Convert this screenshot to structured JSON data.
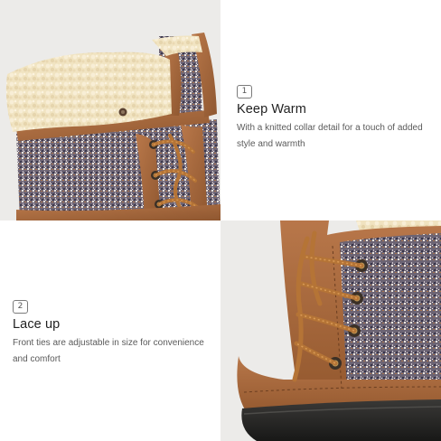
{
  "features": [
    {
      "number": "1",
      "title": "Keep Warm",
      "description": "With a knitted collar detail for a touch of added style and warmth"
    },
    {
      "number": "2",
      "title": "Lace up",
      "description": "Front ties are adjustable in size for convenience and comfort"
    }
  ],
  "colors": {
    "background": "#ffffff",
    "leather": "#a8693d",
    "fleece": "#f3e7c6",
    "tweed": "#7b6f80",
    "lace": "#b57436",
    "rubber": "#2a2927"
  }
}
